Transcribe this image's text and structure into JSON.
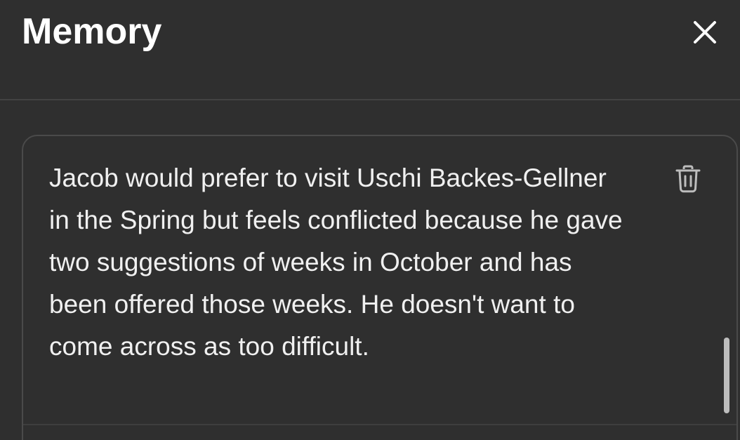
{
  "header": {
    "title": "Memory",
    "close_icon": "close-icon"
  },
  "memories": [
    {
      "text": "Jacob would prefer to visit Uschi Backes-Gellner in the Spring but feels conflicted because he gave two suggestions of weeks in October and has been offered those weeks. He doesn't want to come across as too difficult.",
      "delete_icon": "trash-icon"
    }
  ],
  "colors": {
    "background": "#2f2f2f",
    "text": "#f0f0f0",
    "title": "#ffffff",
    "border": "#4a4a4a"
  }
}
